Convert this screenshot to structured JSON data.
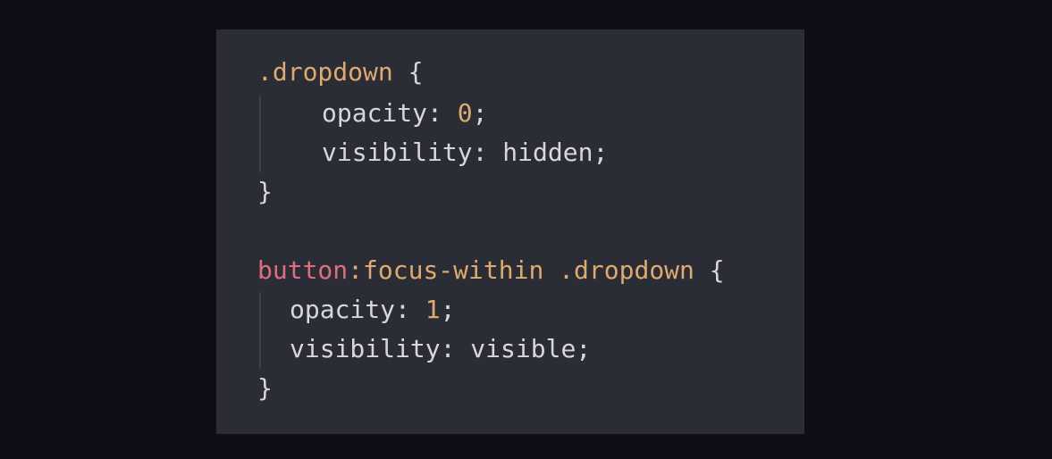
{
  "code": {
    "rule1": {
      "selector": ".dropdown",
      "open_brace": "{",
      "decl1_prop": "opacity",
      "decl1_colon": ":",
      "decl1_value": "0",
      "decl1_semi": ";",
      "decl2_prop": "visibility",
      "decl2_colon": ":",
      "decl2_value": "hidden",
      "decl2_semi": ";",
      "close_brace": "}"
    },
    "rule2": {
      "tag": "button",
      "pseudo": ":focus-within",
      "class": ".dropdown",
      "open_brace": "{",
      "decl1_prop": "opacity",
      "decl1_colon": ":",
      "decl1_value": "1",
      "decl1_semi": ";",
      "decl2_prop": "visibility",
      "decl2_colon": ":",
      "decl2_value": "visible",
      "decl2_semi": ";",
      "close_brace": "}"
    }
  },
  "colors": {
    "page_background": "#0f0e17",
    "code_background": "#2a2d35",
    "selector_class": "#e0a96d",
    "selector_tag": "#e06c7e",
    "number": "#e0a96d",
    "text": "#d5d7dc"
  }
}
